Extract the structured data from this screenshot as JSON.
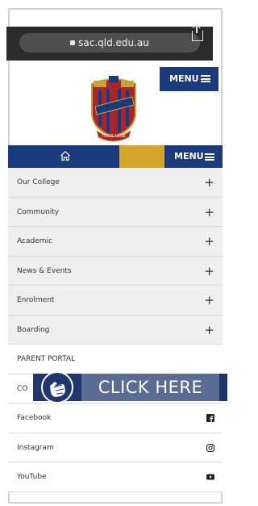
{
  "browser": {
    "url": "sac.qld.edu.au"
  },
  "header": {
    "menu_label": "MENU"
  },
  "navbar": {
    "menu_label": "MENU"
  },
  "menu": {
    "items": [
      {
        "label": "Our College",
        "action": "+"
      },
      {
        "label": "Community",
        "action": "+"
      },
      {
        "label": "Academic",
        "action": "+"
      },
      {
        "label": "News & Events",
        "action": "+"
      },
      {
        "label": "Enrolment",
        "action": "+"
      },
      {
        "label": "Boarding",
        "action": "+"
      },
      {
        "label": "PARENT PORTAL",
        "action": ""
      },
      {
        "label": "CO",
        "action": ""
      },
      {
        "label": "Facebook",
        "icon": "facebook-icon"
      },
      {
        "label": "Instagram",
        "icon": "instagram-icon"
      },
      {
        "label": "YouTube",
        "icon": "youtube-icon"
      }
    ]
  },
  "overlay": {
    "cta": "CLICK HERE"
  },
  "crest": {
    "motto": "TOLLE LEGE"
  },
  "colors": {
    "navy": "#1b3a7c",
    "gold": "#d6a52c",
    "cta_bg": "#5a6c93"
  }
}
